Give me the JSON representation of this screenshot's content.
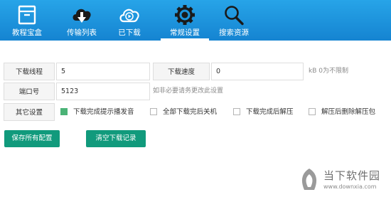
{
  "nav": {
    "items": [
      {
        "label": "教程宝盒",
        "icon": "box-icon"
      },
      {
        "label": "传输列表",
        "icon": "cloud-download-icon"
      },
      {
        "label": "已下载",
        "icon": "cloud-play-icon"
      },
      {
        "label": "常规设置",
        "icon": "gear-icon"
      },
      {
        "label": "搜索资源",
        "icon": "search-icon"
      }
    ],
    "active_index": 3
  },
  "settings": {
    "threads": {
      "label": "下载线程",
      "value": "5"
    },
    "speed": {
      "label": "下载速度",
      "value": "0",
      "hint": "kB 0为不限制"
    },
    "port": {
      "label": "端口号",
      "value": "5123",
      "hint": "如非必要请务更改此设置"
    },
    "other": {
      "label": "其它设置",
      "options": [
        {
          "label": "下载完成提示播发音",
          "checked": true
        },
        {
          "label": "全部下载完后关机",
          "checked": false
        },
        {
          "label": "下载完成后解压",
          "checked": false
        },
        {
          "label": "解压后删除解压包",
          "checked": false
        }
      ]
    }
  },
  "buttons": {
    "save": "保存所有配置",
    "clear": "清空下载记录"
  },
  "watermark": {
    "name": "当下软件园",
    "url": "www.downxia.com"
  },
  "colors": {
    "topbar": "#1b94dc",
    "button": "#119a7c",
    "checked": "#4bb377"
  }
}
